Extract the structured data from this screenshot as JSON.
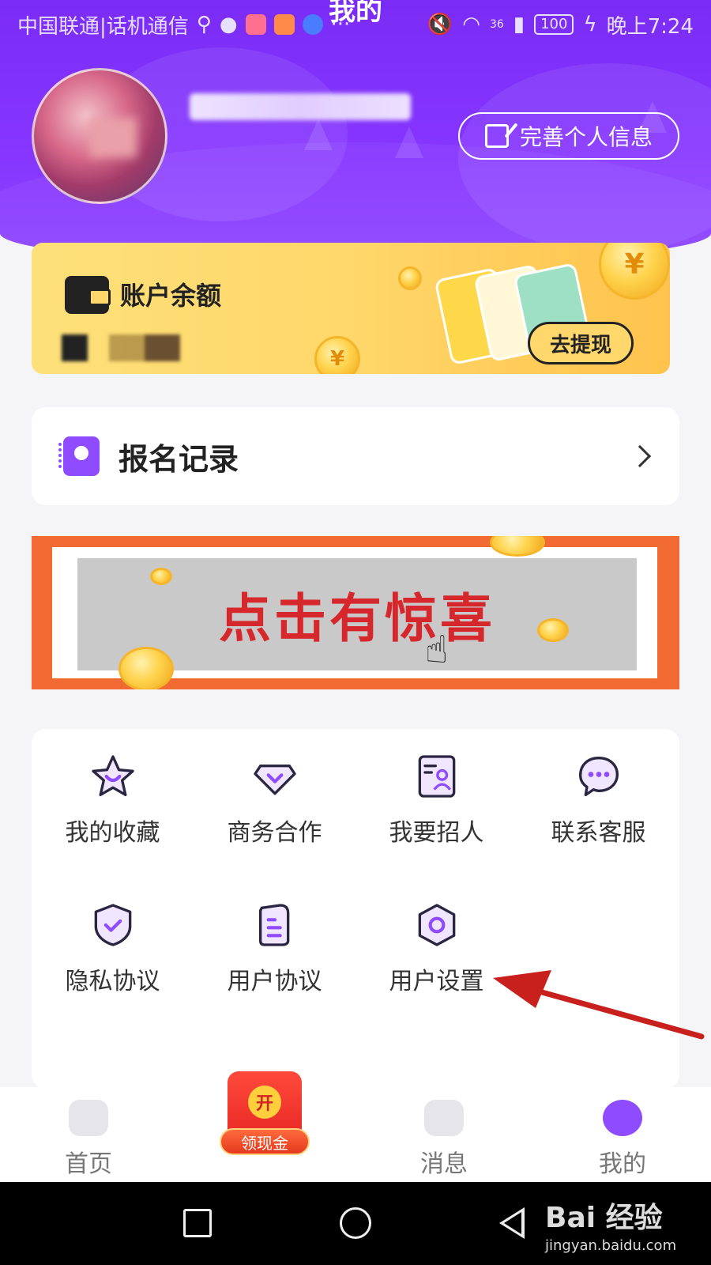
{
  "status_bar": {
    "carrier": "中国联通|话机通信",
    "signal": "36",
    "battery": "100",
    "time": "晚上7:24"
  },
  "page_title": "我的",
  "profile": {
    "edit_button_label": "完善个人信息"
  },
  "balance": {
    "title": "账户余额",
    "withdraw_label": "去提现",
    "coin_symbol": "¥"
  },
  "record": {
    "label": "报名记录"
  },
  "promo": {
    "text": "点击有惊喜"
  },
  "menu": {
    "items": [
      {
        "label": "我的收藏",
        "icon": "star-icon"
      },
      {
        "label": "商务合作",
        "icon": "diamond-icon"
      },
      {
        "label": "我要招人",
        "icon": "recruit-icon"
      },
      {
        "label": "联系客服",
        "icon": "chat-icon"
      },
      {
        "label": "隐私协议",
        "icon": "shield-check-icon"
      },
      {
        "label": "用户协议",
        "icon": "document-icon"
      },
      {
        "label": "用户设置",
        "icon": "settings-hexagon-icon"
      }
    ]
  },
  "tabs": {
    "home": "首页",
    "redpacket_open": "开",
    "redpacket_label": "领现金",
    "messages": "消息",
    "mine": "我的"
  },
  "watermark": {
    "main": "Bai 经验",
    "sub": "jingyan.baidu.com"
  },
  "colors": {
    "brand_purple": "#8636ff",
    "gold": "#ffd76a",
    "promo_orange": "#f16a32",
    "promo_red_text": "#d6282c",
    "annotation_red": "#c8201c"
  }
}
